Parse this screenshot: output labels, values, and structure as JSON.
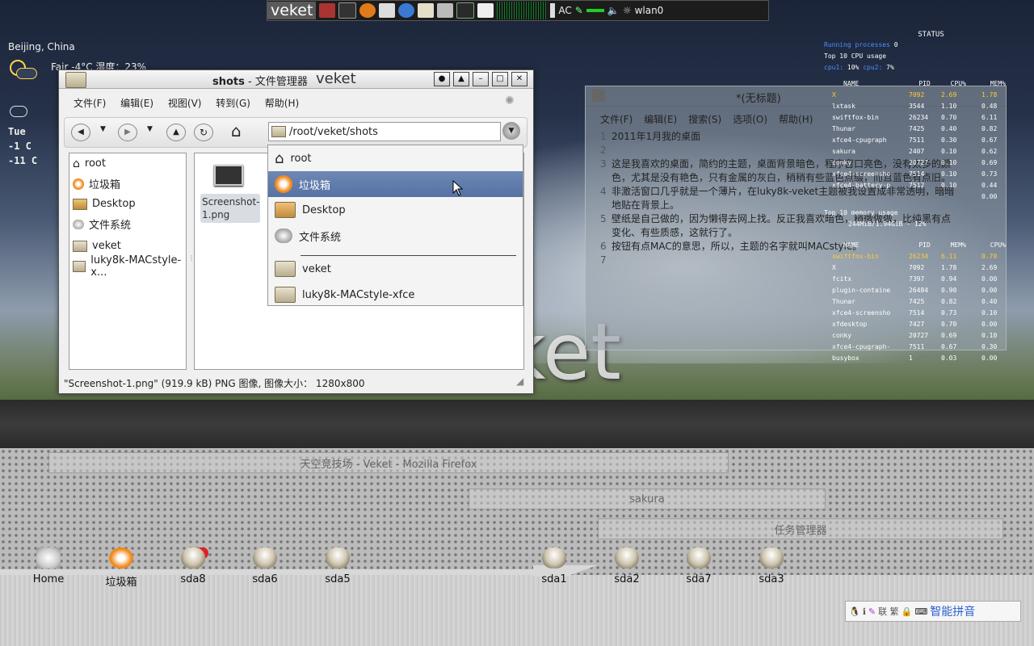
{
  "panel": {
    "logo": "veket",
    "ac": "AC",
    "wlan": "wlan0"
  },
  "weather": {
    "city": "Beijing, China",
    "line1": "Fair  -4°C 湿度：23%",
    "day": "Tue",
    "hi": "-1 C",
    "lo": "-11 C"
  },
  "filemanager": {
    "title_bold": "shots",
    "title_rest": " - 文件管理器",
    "title_brand": "veket",
    "menu": [
      "文件(F)",
      "编辑(E)",
      "视图(V)",
      "转到(G)",
      "帮助(H)"
    ],
    "path": "/root/veket/shots",
    "sidebar": [
      "root",
      "垃圾箱",
      "Desktop",
      "文件系统",
      "veket",
      "luky8k-MACstyle-x..."
    ],
    "file_name": "Screenshot-1.png",
    "status": "\"Screenshot-1.png\" (919.9 kB) PNG 图像, 图像大小： 1280x800",
    "dropdown": [
      "root",
      "垃圾箱",
      "Desktop",
      "文件系统",
      "veket",
      "luky8k-MACstyle-xfce"
    ]
  },
  "editor": {
    "title": "*(无标题)",
    "menu": [
      "文件(F)",
      "编辑(E)",
      "搜索(S)",
      "选项(O)",
      "帮助(H)"
    ],
    "lines": [
      {
        "no": "1",
        "text": "2011年1月我的桌面"
      },
      {
        "no": "2",
        "text": ""
      },
      {
        "no": "3",
        "text": "这是我喜欢的桌面，简约的主题，桌面背景暗色，程序窗口亮色，没有太多的颜"
      },
      {
        "no": "",
        "text": "色，尤其是没有艳色，只有金属的灰白，稍稍有些蓝色点缀，而且蓝色有点旧。"
      },
      {
        "no": "4",
        "text": "非激活窗口几乎就是一个薄片，在luky8k-veket主题被我设置成非常透明，暗暗"
      },
      {
        "no": "",
        "text": "地贴在背景上。"
      },
      {
        "no": "5",
        "text": "壁纸是自己做的，因为懒得去网上找。反正我喜欢暗色，稍微做做，比纯黑有点"
      },
      {
        "no": "",
        "text": "变化、有些质感，这就行了。"
      },
      {
        "no": "6",
        "text": "按钮有点MAC的意思，所以，主题的名字就叫MACstyle。"
      },
      {
        "no": "7",
        "text": ""
      }
    ]
  },
  "conky": {
    "status": "STATUS",
    "running": "Running processes",
    "running_val": "0",
    "cpu_head": "Top 10 CPU usage",
    "cpu1": "cpu1:",
    "cpu1_val": "10%",
    "cpu2": "cpu2:",
    "cpu2_val": "7%",
    "cols": [
      "NAME",
      "PID",
      "CPU%",
      "MEM%"
    ],
    "cpu_rows": [
      [
        "X",
        "7092",
        "2.69",
        "1.78"
      ],
      [
        "lxtask",
        "3544",
        "1.10",
        "0.48"
      ],
      [
        "swiftfox-bin",
        "26234",
        "0.70",
        "6.11"
      ],
      [
        "Thunar",
        "7425",
        "0.40",
        "0.82"
      ],
      [
        "xfce4-cpugraph",
        "7511",
        "0.30",
        "0.67"
      ],
      [
        "sakura",
        "2407",
        "0.10",
        "0.62"
      ],
      [
        "conky",
        "20727",
        "0.10",
        "0.69"
      ],
      [
        "xfce4-screensho",
        "7514",
        "0.10",
        "0.73"
      ],
      [
        "xfce4-battery-p",
        "7512",
        "0.10",
        "0.44"
      ],
      [
        "",
        "",
        "",
        "0.00"
      ]
    ],
    "mem_head": "Top 10 memory usage",
    "mem_used": "244MiB/1.94GiB - 12%",
    "mem_cols": [
      "NAME",
      "PID",
      "MEM%",
      "CPU%"
    ],
    "mem_rows": [
      [
        "swiftfox-bin",
        "26234",
        "6.11",
        "0.70"
      ],
      [
        "X",
        "7092",
        "1.78",
        "2.69"
      ],
      [
        "fcitx",
        "7397",
        "0.94",
        "0.00"
      ],
      [
        "plugin-containe",
        "26484",
        "0.90",
        "0.00"
      ],
      [
        "Thunar",
        "7425",
        "0.82",
        "0.40"
      ],
      [
        "xfce4-screensho",
        "7514",
        "0.73",
        "0.10"
      ],
      [
        "xfdesktop",
        "7427",
        "0.70",
        "0.00"
      ],
      [
        "conky",
        "20727",
        "0.69",
        "0.10"
      ],
      [
        "xfce4-cpugraph-",
        "7511",
        "0.67",
        "0.30"
      ],
      [
        "busybox",
        "1",
        "0.03",
        "0.00"
      ]
    ]
  },
  "wallpaper_text": "ket",
  "taskbar": {
    "firefox": "天空竞技场 - Veket - Mozilla Firefox",
    "sakura": "sakura",
    "taskmgr": "任务管理器"
  },
  "dock": [
    "Home",
    "垃圾箱",
    "sda8",
    "sda6",
    "sda5",
    "sda1",
    "sda2",
    "sda7",
    "sda3"
  ],
  "tray": {
    "ime": "智能拼音",
    "icons": "联 繁"
  },
  "colors": {
    "accent": "#5572a4",
    "conky_highlight": "#ffcc33",
    "conky_blue": "#4a90ff"
  }
}
